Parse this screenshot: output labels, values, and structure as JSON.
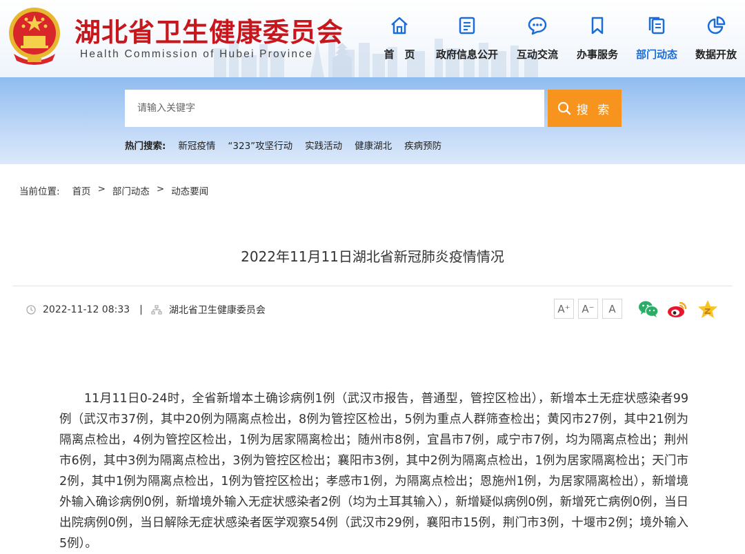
{
  "header": {
    "title": "湖北省卫生健康委员会",
    "subtitle": "Health Commission of Hubei Province",
    "emblem": "national-emblem"
  },
  "nav": {
    "items": [
      {
        "label": "首　页",
        "icon": "home-icon"
      },
      {
        "label": "政府信息公开",
        "icon": "document-list-icon"
      },
      {
        "label": "互动交流",
        "icon": "chat-bubble-icon"
      },
      {
        "label": "办事服务",
        "icon": "bookmark-icon"
      },
      {
        "label": "部门动态",
        "icon": "files-icon",
        "active": true
      },
      {
        "label": "数据开放",
        "icon": "pie-chart-icon"
      }
    ],
    "active_color": "#1a6dd8"
  },
  "search": {
    "placeholder": "请输入关键字",
    "button_label": "搜 索",
    "button_color": "#f7941e",
    "hot_title": "热门搜索:",
    "hot_links": [
      "新冠疫情",
      "“323”攻坚行动",
      "实践活动",
      "健康湖北",
      "疾病预防"
    ]
  },
  "breadcrumb": {
    "label": "当前位置:",
    "items": [
      "首页",
      "部门动态",
      "动态要闻"
    ],
    "separator": ">"
  },
  "article": {
    "title": "2022年11月11日湖北省新冠肺炎疫情情况",
    "date": "2022-11-12 08:33",
    "meta_separator": "|",
    "source": "湖北省卫生健康委员会",
    "font_buttons": [
      "A⁺",
      "A⁻",
      "A"
    ],
    "share": [
      "wechat-icon",
      "weibo-icon",
      "favorite-star-icon"
    ],
    "body": "11月11日0-24时，全省新增本土确诊病例1例（武汉市报告，普通型，管控区检出），新增本土无症状感染者99例（武汉市37例，其中20例为隔离点检出，8例为管控区检出，5例为重点人群筛查检出；黄冈市27例，其中21例为隔离点检出，4例为管控区检出，1例为居家隔离检出；随州市8例，宜昌市7例，咸宁市7例，均为隔离点检出；荆州市6例，其中3例为隔离点检出，3例为管控区检出；襄阳市3例，其中2例为隔离点检出，1例为居家隔离检出；天门市2例，其中1例为隔离点检出，1例为管控区检出；孝感市1例，为隔离点检出；恩施州1例，为居家隔离检出），新增境外输入确诊病例0例，新增境外输入无症状感染者2例（均为土耳其输入），新增疑似病例0例，新增死亡病例0例，当日出院病例0例，当日解除无症状感染者医学观察54例（武汉市29例，襄阳市15例，荆门市3例，十堰市2例；境外输入5例）。"
  }
}
